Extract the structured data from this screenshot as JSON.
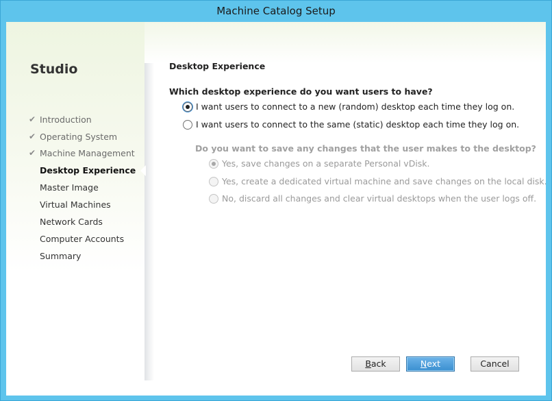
{
  "window": {
    "title": "Machine Catalog Setup"
  },
  "sidebar": {
    "studio_label": "Studio",
    "steps": [
      {
        "label": "Introduction",
        "state": "done"
      },
      {
        "label": "Operating System",
        "state": "done"
      },
      {
        "label": "Machine Management",
        "state": "done"
      },
      {
        "label": "Desktop Experience",
        "state": "current"
      },
      {
        "label": "Master Image",
        "state": "pending"
      },
      {
        "label": "Virtual Machines",
        "state": "pending"
      },
      {
        "label": "Network Cards",
        "state": "pending"
      },
      {
        "label": "Computer Accounts",
        "state": "pending"
      },
      {
        "label": "Summary",
        "state": "pending"
      }
    ],
    "check_icon": "✔"
  },
  "main": {
    "section_title": "Desktop Experience",
    "question": "Which desktop experience do you want users to have?",
    "options": [
      {
        "label": "I want users to connect to a new (random) desktop each time they log on.",
        "checked": true
      },
      {
        "label": "I want users to connect to the same (static) desktop each time they log on.",
        "checked": false
      }
    ],
    "sub_question": "Do you want to save any changes that the user makes to the desktop?",
    "sub_options": [
      {
        "label": "Yes, save changes on a separate Personal vDisk.",
        "checked": true,
        "enabled": false
      },
      {
        "label": "Yes, create a dedicated virtual machine and save changes on the local disk.",
        "checked": false,
        "enabled": false
      },
      {
        "label": "No, discard all changes and clear virtual desktops when the user logs off.",
        "checked": false,
        "enabled": false
      }
    ]
  },
  "buttons": {
    "back": {
      "accel": "B",
      "rest": "ack"
    },
    "next": {
      "accel": "N",
      "rest": "ext"
    },
    "cancel": "Cancel"
  },
  "colors": {
    "title_bar": "#5ec4ec",
    "primary_button": "#3a8fd0"
  }
}
